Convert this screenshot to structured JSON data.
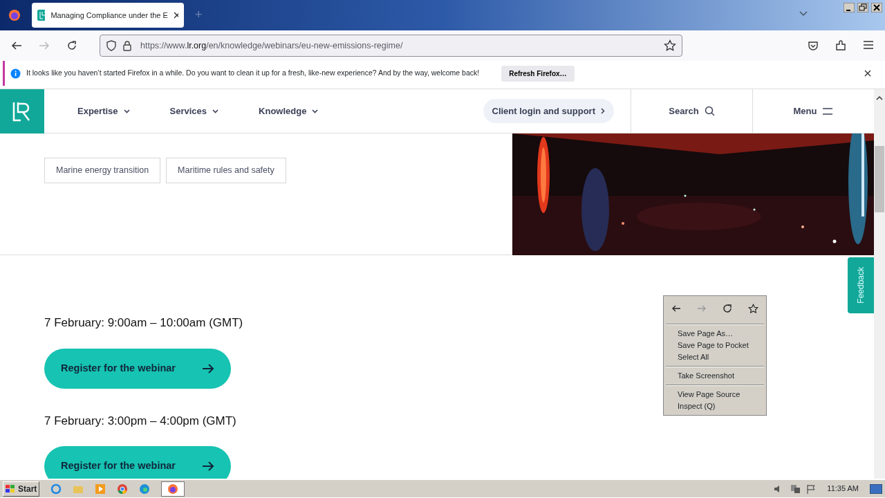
{
  "browser": {
    "tabs": [
      {
        "title": "Managing Compliance under the E",
        "selected": true
      }
    ],
    "new_tab": "+",
    "url": {
      "prefix": "https://www.",
      "domain": "lr.org",
      "path": "/en/knowledge/webinars/eu-new-emissions-regime/"
    }
  },
  "notification": {
    "message": "It looks like you haven’t started Firefox in a while. Do you want to clean it up for a fresh, like-new experience? And by the way, welcome back!",
    "button": "Refresh Firefox…"
  },
  "site_nav": {
    "items": [
      {
        "label": "Expertise"
      },
      {
        "label": "Services"
      },
      {
        "label": "Knowledge"
      }
    ],
    "client_login": "Client login and support",
    "search": "Search",
    "menu": "Menu"
  },
  "tags": [
    "Marine energy transition",
    "Maritime rules and safety"
  ],
  "sessions": [
    {
      "time": "7 February: 9:00am – 10:00am (GMT)",
      "button": "Register for the webinar"
    },
    {
      "time": "7 February: 3:00pm – 4:00pm (GMT)",
      "button": "Register for the webinar"
    }
  ],
  "feedback": "Feedback",
  "context_menu": {
    "groups": [
      [
        "Save Page As…",
        "Save Page to Pocket",
        "Select All"
      ],
      [
        "Take Screenshot"
      ],
      [
        "View Page Source",
        "Inspect (Q)"
      ]
    ]
  },
  "taskbar": {
    "start": "Start",
    "clock": "11:35 AM"
  }
}
